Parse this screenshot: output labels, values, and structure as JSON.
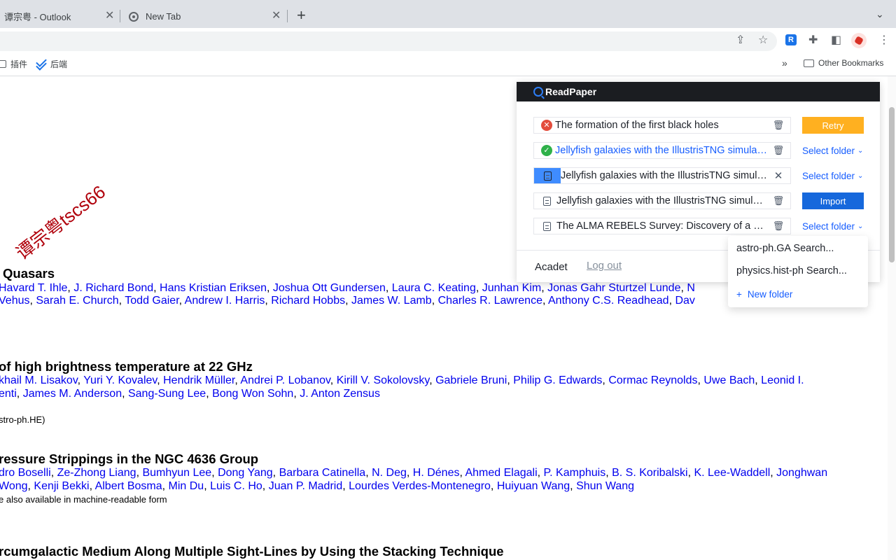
{
  "browser": {
    "tabs": [
      {
        "title": "谭宗粤 - Outlook",
        "close": "✕"
      },
      {
        "title": "New Tab",
        "close": "✕"
      }
    ],
    "new_tab": "+",
    "tab_menu": "⌄",
    "bookmarks": [
      {
        "label": "插件"
      },
      {
        "label": "后端"
      }
    ],
    "bookmarks_overflow": "»",
    "other_bookmarks": "Other Bookmarks"
  },
  "watermark": "谭宗粤tscs66",
  "entries": [
    {
      "title": "Quasars",
      "authors_line1": [
        "Havard T. Ihle",
        "J. Richard Bond",
        "Hans Kristian Eriksen",
        "Joshua Ott Gundersen",
        "Laura C. Keating",
        "Junhan Kim",
        "Jonas Gahr Sturtzel Lunde",
        "N"
      ],
      "authors_line2": [
        "Vehus",
        "Sarah E. Church",
        "Todd Gaier",
        "Andrew I. Harris",
        "Richard Hobbs",
        "James W. Lamb",
        "Charles R. Lawrence",
        "Anthony C.S. Readhead",
        "Dav"
      ]
    },
    {
      "title": "of high brightness temperature at 22 GHz",
      "authors_line1": [
        "khail M. Lisakov",
        "Yuri Y. Kovalev",
        "Hendrik Müller",
        "Andrei P. Lobanov",
        "Kirill V. Sokolovsky",
        "Gabriele Bruni",
        "Philip G. Edwards",
        "Cormac Reynolds",
        "Uwe Bach",
        "Leonid I."
      ],
      "authors_line2": [
        "enti",
        "James M. Anderson",
        "Sang-Sung Lee",
        "Bong Won Sohn",
        "J. Anton Zensus"
      ],
      "meta": "stro-ph.HE)"
    },
    {
      "title": "ressure Strippings in the NGC 4636 Group",
      "authors_line1": [
        "dro Boselli",
        "Ze-Zhong Liang",
        "Bumhyun Lee",
        "Dong Yang",
        "Barbara Catinella",
        "N. Deg",
        "H. Dénes",
        "Ahmed Elagali",
        "P. Kamphuis",
        "B. S. Koribalski",
        "K. Lee-Waddell",
        "Jonghwan"
      ],
      "authors_line2": [
        "Wong",
        "Kenji Bekki",
        "Albert Bosma",
        "Min Du",
        "Luis C. Ho",
        "Juan P. Madrid",
        "Lourdes Verdes-Montenegro",
        "Huiyuan Wang",
        "Shun Wang"
      ],
      "meta": "e also available in machine-readable form"
    },
    {
      "title": "rcumgalactic Medium Along Multiple Sight-Lines by Using the Stacking Technique"
    }
  ],
  "readpaper": {
    "brand": "ReadPaper",
    "rows": [
      {
        "status": "error",
        "name": "The formation of the first black holes",
        "action": "Retry"
      },
      {
        "status": "success",
        "name": "Jellyfish galaxies with the IllustrisTNG simulations",
        "action": "Select folder"
      },
      {
        "status": "uploading",
        "name": "Jellyfish galaxies with the IllustrisTNG simulations",
        "action": "Select folder"
      },
      {
        "status": "ready",
        "name": "Jellyfish galaxies with the IllustrisTNG simulations",
        "action": "Import"
      },
      {
        "status": "ready",
        "name": "The ALMA REBELS Survey: Discovery of a massive",
        "action": "Select folder"
      }
    ],
    "account": "Acadet",
    "logout": "Log out",
    "folder_dropdown": {
      "items": [
        "astro-ph.GA Search...",
        "physics.hist-ph Search..."
      ],
      "new_folder": "New folder"
    }
  }
}
